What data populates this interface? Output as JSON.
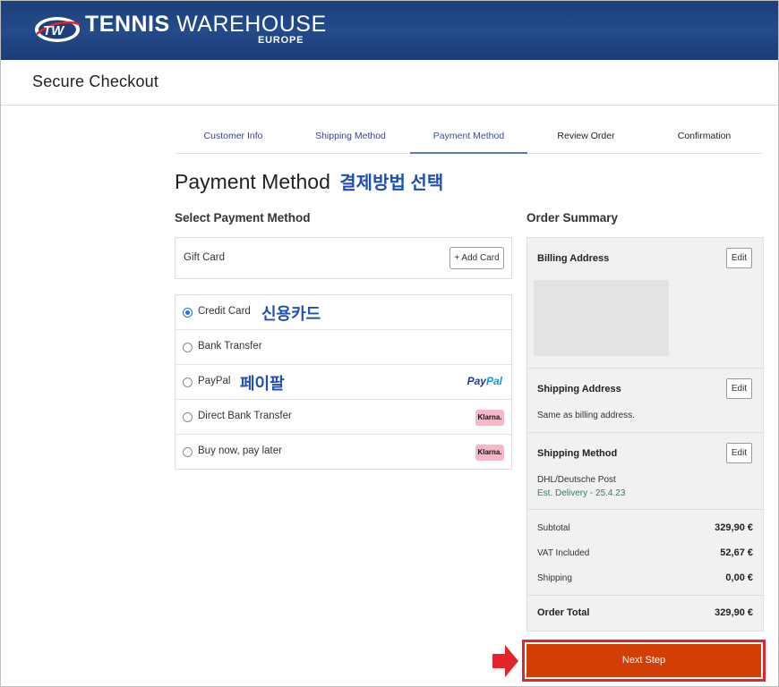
{
  "header": {
    "logo_letters": "TW",
    "brand_bold": "TENNIS",
    "brand_light": "WAREHOUSE",
    "brand_sub": "EUROPE"
  },
  "subheader": {
    "title": "Secure Checkout"
  },
  "steps": [
    {
      "label": "Customer Info",
      "active": false
    },
    {
      "label": "Shipping Method",
      "active": false
    },
    {
      "label": "Payment Method",
      "active": true
    },
    {
      "label": "Review Order",
      "active": false
    },
    {
      "label": "Confirmation",
      "active": false
    }
  ],
  "page_title": "Payment Method",
  "annotations": {
    "payment_title_ko": "결제방법 선택",
    "credit_card_ko": "신용카드",
    "paypal_ko": "페이팔"
  },
  "payment": {
    "section_title": "Select Payment Method",
    "gift_card_label": "Gift Card",
    "add_card_button": "+ Add Card",
    "options": [
      {
        "label": "Credit Card",
        "selected": true
      },
      {
        "label": "Bank Transfer",
        "selected": false
      },
      {
        "label": "PayPal",
        "selected": false,
        "logo": "PayPal"
      },
      {
        "label": "Direct Bank Transfer",
        "selected": false,
        "logo": "Klarna."
      },
      {
        "label": "Buy now, pay later",
        "selected": false,
        "logo": "Klarna."
      }
    ],
    "paypal_logo_a": "Pay",
    "paypal_logo_b": "Pal",
    "klarna_logo": "Klarna."
  },
  "summary": {
    "title": "Order Summary",
    "billing_address_label": "Billing Address",
    "shipping_address_label": "Shipping Address",
    "shipping_address_value": "Same as billing address.",
    "shipping_method_label": "Shipping Method",
    "shipping_method_value": "DHL/Deutsche Post",
    "est_delivery": "Est. Delivery - 25.4.23",
    "edit_label": "Edit",
    "subtotal_label": "Subtotal",
    "subtotal_value": "329,90 €",
    "vat_label": "VAT Included",
    "vat_value": "52,67 €",
    "shipping_label": "Shipping",
    "shipping_value": "0,00 €",
    "total_label": "Order Total",
    "total_value": "329,90 €"
  },
  "next_button": "Next Step",
  "colors": {
    "header_blue": "#1d3f7a",
    "accent_orange": "#d13f06",
    "annotation_red": "#e3242b",
    "korean_blue": "#1f4fb3",
    "delivery_green": "#2e7d5b"
  },
  "icons": {
    "logo": "tw-logo-icon",
    "radio": "radio-icon",
    "arrow": "red-arrow-icon"
  }
}
